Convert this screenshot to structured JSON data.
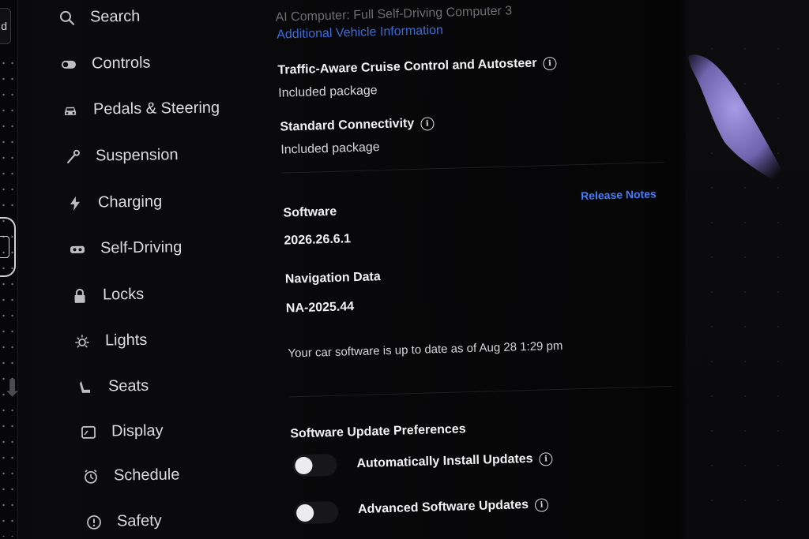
{
  "edge": {
    "tab_text": "d"
  },
  "sidebar": {
    "items": [
      {
        "id": "search",
        "label": "Search",
        "icon": "search-icon"
      },
      {
        "id": "controls",
        "label": "Controls",
        "icon": "toggle-icon"
      },
      {
        "id": "pedals",
        "label": "Pedals & Steering",
        "icon": "car-icon"
      },
      {
        "id": "suspension",
        "label": "Suspension",
        "icon": "wrench-icon"
      },
      {
        "id": "charging",
        "label": "Charging",
        "icon": "lightning-bolt-icon"
      },
      {
        "id": "self-driving",
        "label": "Self-Driving",
        "icon": "steering-wheel-icon"
      },
      {
        "id": "locks",
        "label": "Locks",
        "icon": "lock-icon"
      },
      {
        "id": "lights",
        "label": "Lights",
        "icon": "sun-icon"
      },
      {
        "id": "seats",
        "label": "Seats",
        "icon": "seat-icon"
      },
      {
        "id": "display",
        "label": "Display",
        "icon": "display-icon"
      },
      {
        "id": "schedule",
        "label": "Schedule",
        "icon": "alarm-clock-icon"
      },
      {
        "id": "safety",
        "label": "Safety",
        "icon": "alert-circle-icon"
      }
    ]
  },
  "main": {
    "computer_line": "AI Computer: Full Self-Driving Computer 3",
    "additional_info_link": "Additional Vehicle Information",
    "packages": [
      {
        "title": "Traffic-Aware Cruise Control and Autosteer",
        "status": "Included package"
      },
      {
        "title": "Standard Connectivity",
        "status": "Included package"
      }
    ],
    "release_notes_link": "Release Notes",
    "software": {
      "label": "Software",
      "version": "2026.26.6.1"
    },
    "navigation": {
      "label": "Navigation Data",
      "version": "NA-2025.44"
    },
    "status_text": "Your car software is up to date as of Aug 28 1:29 pm",
    "preferences": {
      "title": "Software Update Preferences",
      "options": [
        {
          "label": "Automatically Install Updates",
          "enabled": false
        },
        {
          "label": "Advanced Software Updates",
          "enabled": false
        }
      ]
    }
  },
  "colors": {
    "background": "#030304",
    "link": "#3e6ad6",
    "release_notes": "#4a7cf2",
    "glare": "#9c8ce0"
  }
}
